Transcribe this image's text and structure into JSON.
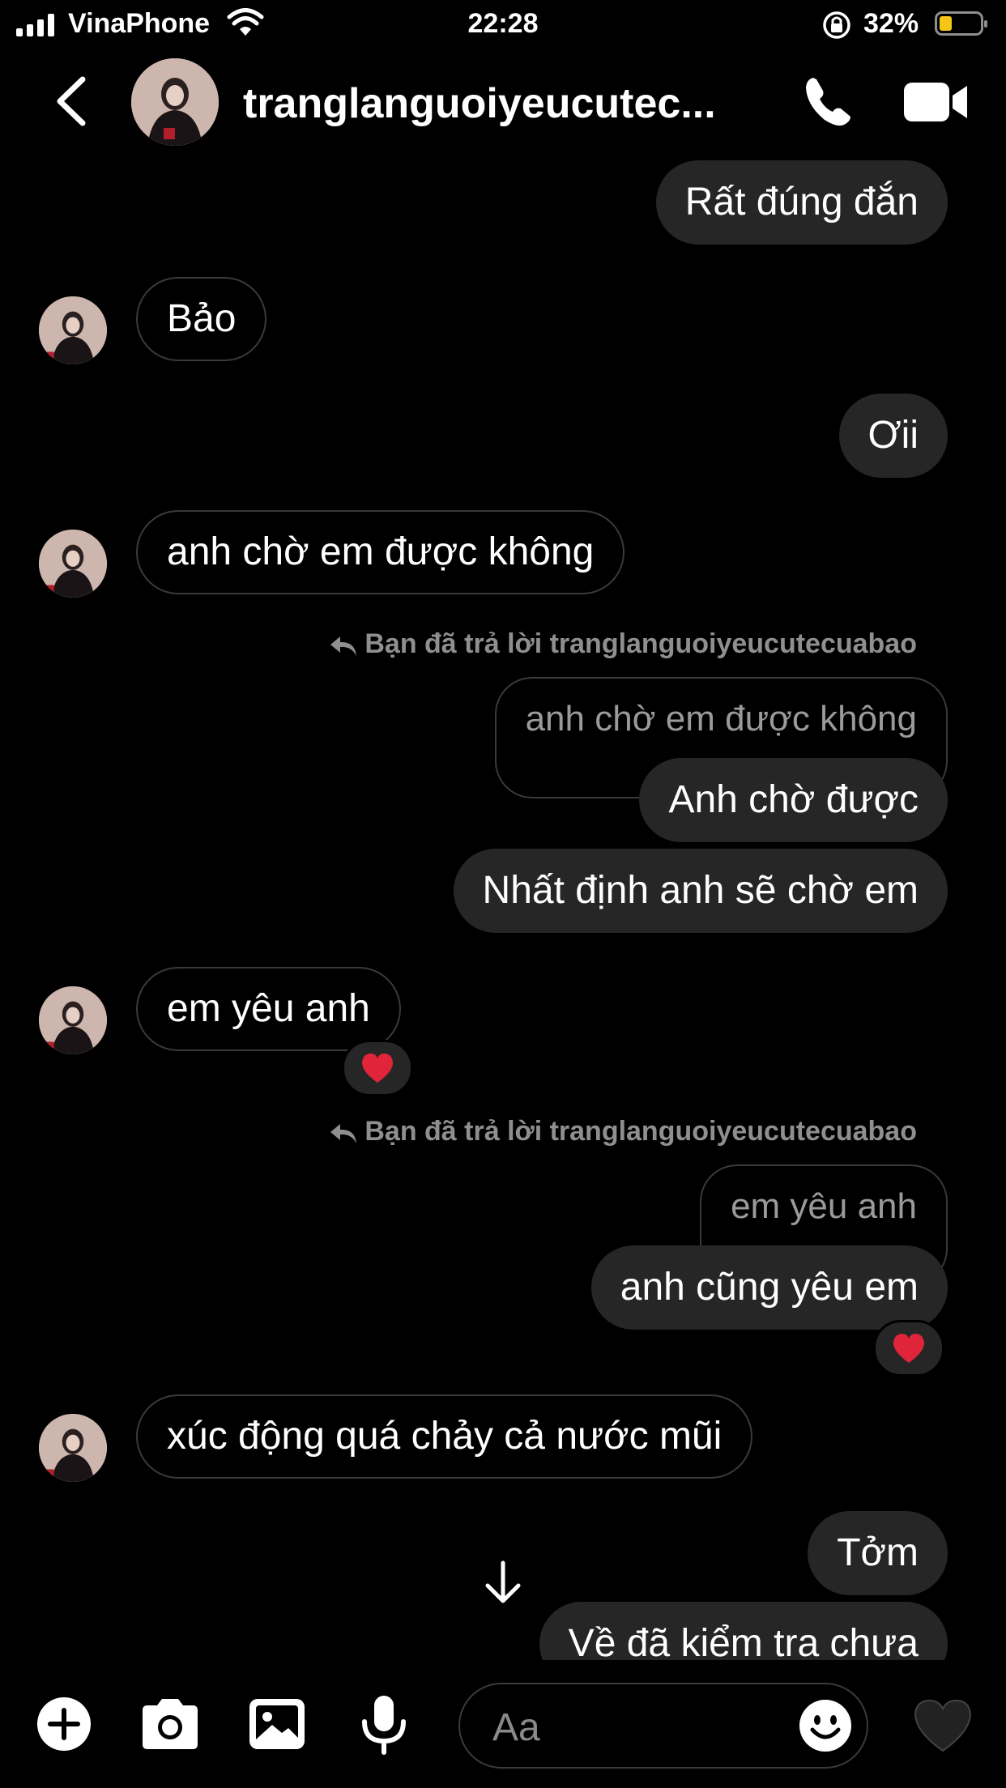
{
  "status_bar": {
    "carrier": "VinaPhone",
    "time": "22:28",
    "battery_percent": "32%",
    "battery_level": 0.32,
    "battery_color": "#f5c518"
  },
  "header": {
    "username": "tranglanguoiyeucutec...",
    "back_icon": "chevron-left-icon",
    "call_icon": "phone-icon",
    "video_icon": "video-camera-icon"
  },
  "messages": [
    {
      "from": "me",
      "text": "Rất đúng đắn"
    },
    {
      "from": "them",
      "text": "Bảo"
    },
    {
      "from": "me",
      "text": "Ơii"
    },
    {
      "from": "them",
      "text": "anh chờ em được không"
    },
    {
      "from": "me",
      "reply_label": "Bạn đã trả lời tranglanguoiyeucutecuabao",
      "quoted": "anh chờ em được không",
      "text": "Anh chờ được"
    },
    {
      "from": "me",
      "text": "Nhất định anh sẽ chờ em"
    },
    {
      "from": "them",
      "text": "em yêu anh",
      "reaction": "❤️"
    },
    {
      "from": "me",
      "reply_label": "Bạn đã trả lời tranglanguoiyeucutecuabao",
      "quoted": "em yêu anh",
      "text": "anh cũng yêu em",
      "reaction": "❤️"
    },
    {
      "from": "them",
      "text": "xúc động quá chảy cả nước mũi"
    },
    {
      "from": "me",
      "text": "Tởm"
    },
    {
      "from": "me",
      "text": "Về đã kiểm tra chưa"
    }
  ],
  "composer": {
    "placeholder": "Aa",
    "icons": [
      "plus-icon",
      "camera-icon",
      "image-icon",
      "microphone-icon",
      "sticker-icon",
      "heart-icon"
    ]
  },
  "colors": {
    "background": "#000000",
    "my_bubble": "#262626",
    "their_bubble_border": "#3a3a3a",
    "reaction_heart": "#e0243a"
  }
}
